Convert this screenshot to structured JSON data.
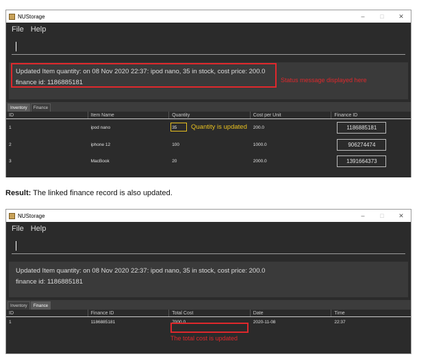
{
  "window_title": "NUStorage",
  "window_controls": {
    "minimize": "–",
    "maximize": "□",
    "close": "✕"
  },
  "menu": [
    "File",
    "Help"
  ],
  "status_message_line1": "Updated Item quantity: on 08 Nov 2020 22:37: ipod nano, 35 in stock, cost price: 200.0",
  "status_message_line2": "finance id: 1186885181",
  "tabs": [
    "Inventory",
    "Finance"
  ],
  "inventory": {
    "columns": [
      "ID",
      "Item Name",
      "Quantity",
      "Cost per Unit",
      "Finance ID"
    ],
    "rows": [
      [
        "1",
        "ipod nano",
        "35",
        "200.0",
        "1186885181"
      ],
      [
        "2",
        "iphone 12",
        "100",
        "1000.0",
        "906274474"
      ],
      [
        "3",
        "MacBook",
        "20",
        "2000.0",
        "1391664373"
      ]
    ]
  },
  "finance": {
    "columns": [
      "ID",
      "Finance ID",
      "Total Cost",
      "Date",
      "Time"
    ],
    "rows": [
      [
        "1",
        "1186885181",
        "7000.0",
        "2020-11-08",
        "22:37"
      ]
    ]
  },
  "annotations": {
    "status_note": "Status message displayed here",
    "quantity_note": "Quantity is updated",
    "total_note": "The total cost is updated",
    "result_label": "Result:",
    "result_text": " The linked finance record is also updated."
  },
  "colors": {
    "annotation_red": "#e0282c",
    "annotation_yellow": "#e8c020",
    "app_bg": "#2b2b2b"
  }
}
